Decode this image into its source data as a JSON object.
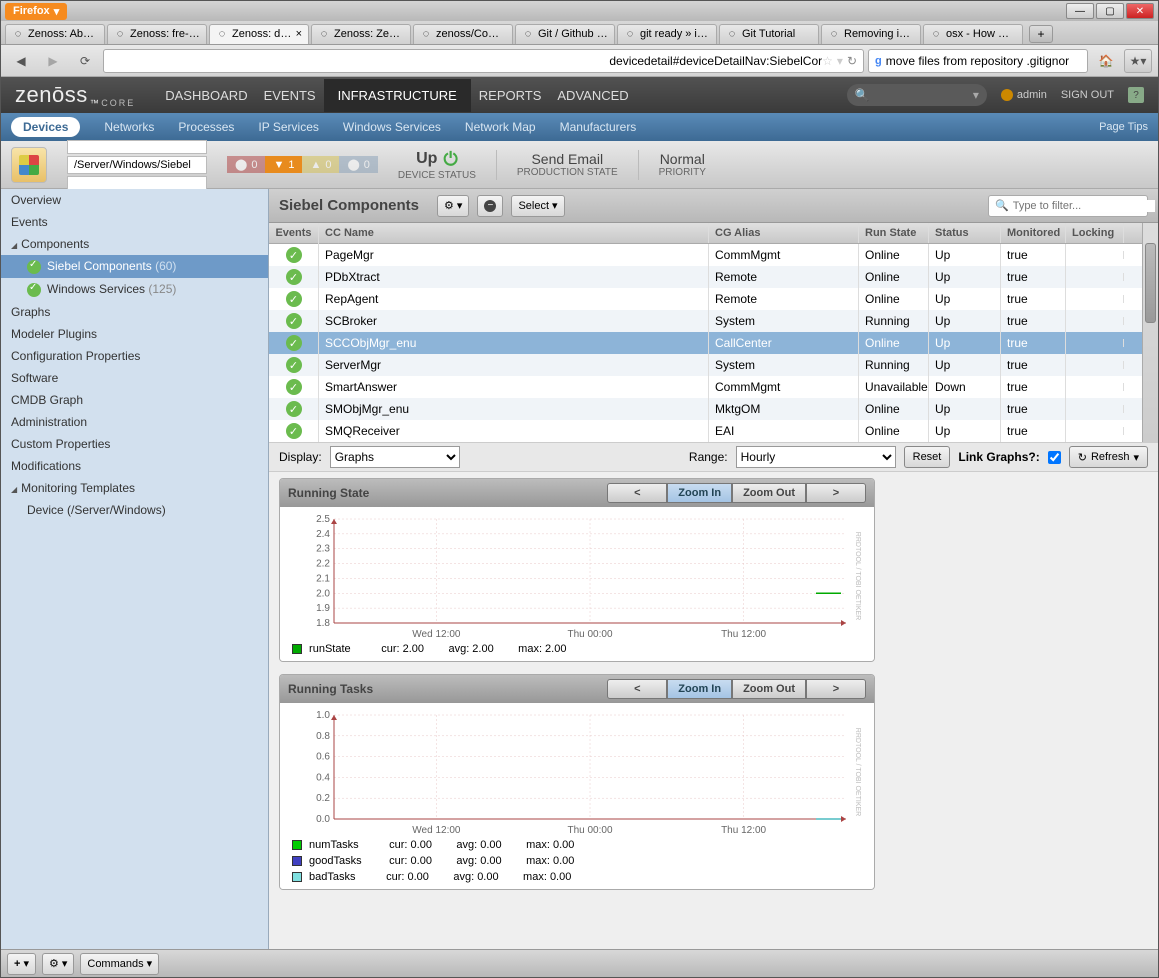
{
  "browser": {
    "menu_label": "Firefox",
    "tabs": [
      {
        "label": "Zenoss: About",
        "icon": "zenoss"
      },
      {
        "label": "Zenoss: fre-p...",
        "icon": "zenoss"
      },
      {
        "label": "Zenoss: df...",
        "icon": "zenoss",
        "active": true,
        "closable": true
      },
      {
        "label": "Zenoss: ZenP...",
        "icon": "zenoss"
      },
      {
        "label": "zenoss/Com...",
        "icon": "generic"
      },
      {
        "label": "Git / Github Z...",
        "icon": "zenoss"
      },
      {
        "label": "git ready » ig...",
        "icon": "git"
      },
      {
        "label": "Git Tutorial",
        "icon": "git"
      },
      {
        "label": "Removing ig...",
        "icon": "wp"
      },
      {
        "label": "osx - How Ca...",
        "icon": "so"
      }
    ],
    "url_display": "devicedetail#deviceDetailNav:SiebelCor",
    "search_text": "move files from repository .gitignor"
  },
  "header": {
    "logo_main": "zenōss",
    "logo_sub": "CORE",
    "nav": [
      "DASHBOARD",
      "EVENTS",
      "INFRASTRUCTURE",
      "REPORTS",
      "ADVANCED"
    ],
    "nav_active_index": 2,
    "user": "admin",
    "signout": "SIGN OUT"
  },
  "subnav": {
    "items": [
      "Devices",
      "Networks",
      "Processes",
      "IP Services",
      "Windows Services",
      "Network Map",
      "Manufacturers"
    ],
    "active_index": 0,
    "right": "Page Tips"
  },
  "breadcrumb": {
    "path": "/Server/Windows/Siebel",
    "severity": {
      "critical": "0",
      "error": "1",
      "warning": "0",
      "info": "0"
    },
    "status": {
      "value": "Up",
      "label": "DEVICE STATUS"
    },
    "prod_state": {
      "value": "Send Email",
      "label": "PRODUCTION STATE"
    },
    "priority": {
      "value": "Normal",
      "label": "PRIORITY"
    }
  },
  "sidebar": {
    "items": [
      {
        "label": "Overview"
      },
      {
        "label": "Events"
      },
      {
        "label": "Components",
        "expandable": true
      },
      {
        "label": "Siebel Components",
        "sub": true,
        "check": true,
        "count": "(60)",
        "selected": true
      },
      {
        "label": "Windows Services",
        "sub": true,
        "check": true,
        "count": "(125)"
      },
      {
        "label": "Graphs"
      },
      {
        "label": "Modeler Plugins"
      },
      {
        "label": "Configuration Properties"
      },
      {
        "label": "Software"
      },
      {
        "label": "CMDB Graph"
      },
      {
        "label": "Administration"
      },
      {
        "label": "Custom Properties"
      },
      {
        "label": "Modifications"
      },
      {
        "label": "Monitoring Templates",
        "expandable": true
      },
      {
        "label": "Device (/Server/Windows)",
        "sub": true
      }
    ]
  },
  "content": {
    "title": "Siebel Components",
    "select_label": "Select",
    "filter_placeholder": "Type to filter...",
    "columns": {
      "events": "Events",
      "cc_name": "CC Name",
      "cg_alias": "CG Alias",
      "run_state": "Run State",
      "status": "Status",
      "monitored": "Monitored",
      "locking": "Locking"
    },
    "rows": [
      {
        "cc": "PageMgr",
        "cg": "CommMgmt",
        "run": "Online",
        "status": "Up",
        "mon": "true"
      },
      {
        "cc": "PDbXtract",
        "cg": "Remote",
        "run": "Online",
        "status": "Up",
        "mon": "true"
      },
      {
        "cc": "RepAgent",
        "cg": "Remote",
        "run": "Online",
        "status": "Up",
        "mon": "true"
      },
      {
        "cc": "SCBroker",
        "cg": "System",
        "run": "Running",
        "status": "Up",
        "mon": "true"
      },
      {
        "cc": "SCCObjMgr_enu",
        "cg": "CallCenter",
        "run": "Online",
        "status": "Up",
        "mon": "true",
        "selected": true
      },
      {
        "cc": "ServerMgr",
        "cg": "System",
        "run": "Running",
        "status": "Up",
        "mon": "true"
      },
      {
        "cc": "SmartAnswer",
        "cg": "CommMgmt",
        "run": "Unavailable",
        "status": "Down",
        "mon": "true"
      },
      {
        "cc": "SMObjMgr_enu",
        "cg": "MktgOM",
        "run": "Online",
        "status": "Up",
        "mon": "true"
      },
      {
        "cc": "SMQReceiver",
        "cg": "EAI",
        "run": "Online",
        "status": "Up",
        "mon": "true"
      }
    ]
  },
  "display_bar": {
    "display_label": "Display:",
    "display_value": "Graphs",
    "range_label": "Range:",
    "range_value": "Hourly",
    "reset": "Reset",
    "link_label": "Link Graphs?:",
    "link_checked": true,
    "refresh": "Refresh"
  },
  "graph_buttons": {
    "prev": "<",
    "zoom_in": "Zoom In",
    "zoom_out": "Zoom Out",
    "next": ">"
  },
  "chart_data": [
    {
      "title": "Running State",
      "type": "line",
      "x_ticks": [
        "Wed 12:00",
        "Thu 00:00",
        "Thu 12:00"
      ],
      "y_ticks": [
        1.8,
        1.9,
        2.0,
        2.1,
        2.2,
        2.3,
        2.4,
        2.5
      ],
      "ylim": [
        1.8,
        2.5
      ],
      "series": [
        {
          "name": "runState",
          "color": "#00aa00",
          "cur": "2.00",
          "avg": "2.00",
          "max": "2.00",
          "value": 2.0
        }
      ],
      "watermark": "RRDTOOL / TOBI OETIKER"
    },
    {
      "title": "Running Tasks",
      "type": "line",
      "x_ticks": [
        "Wed 12:00",
        "Thu 00:00",
        "Thu 12:00"
      ],
      "y_ticks": [
        0.0,
        0.2,
        0.4,
        0.6,
        0.8,
        1.0
      ],
      "ylim": [
        0.0,
        1.0
      ],
      "series": [
        {
          "name": "numTasks",
          "color": "#00cc00",
          "cur": "0.00",
          "avg": "0.00",
          "max": "0.00",
          "value": 0.0
        },
        {
          "name": "goodTasks",
          "color": "#4040c0",
          "cur": "0.00",
          "avg": "0.00",
          "max": "0.00",
          "value": 0.0
        },
        {
          "name": "badTasks",
          "color": "#80e0e0",
          "cur": "0.00",
          "avg": "0.00",
          "max": "0.00",
          "value": 0.0
        }
      ],
      "watermark": "RRDTOOL / TOBI OETIKER"
    }
  ],
  "bottom": {
    "commands": "Commands"
  }
}
